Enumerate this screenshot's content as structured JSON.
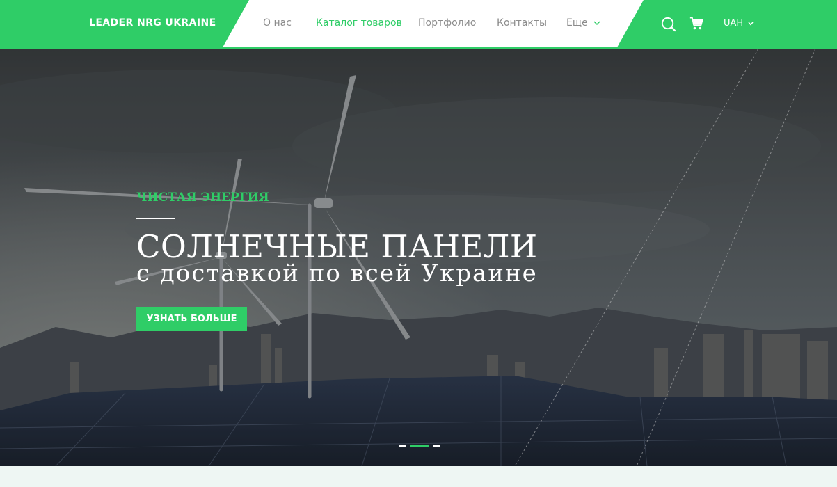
{
  "header": {
    "logo": "LEADER NRG UKRAINE",
    "nav": [
      {
        "label": "О нас",
        "active": false
      },
      {
        "label": "Каталог товаров",
        "active": true
      },
      {
        "label": "Портфолио",
        "active": false
      },
      {
        "label": "Контакты",
        "active": false
      },
      {
        "label": "Еще",
        "active": false
      }
    ],
    "currency": "UAH",
    "icons": [
      "search-icon",
      "cart-icon",
      "chevron-down-icon"
    ]
  },
  "hero": {
    "eyebrow": "ЧИСТАЯ ЭНЕРГИЯ",
    "title": "СОЛНЕЧНЫЕ ПАНЕЛИ",
    "subtitle": "с доставкой по всей Украине",
    "button": "УЗНАТЬ БОЛЬШЕ",
    "slides": 3,
    "active_slide": 2
  },
  "colors": {
    "brand_green": "#2fcd67",
    "nav_text": "#8c8c8c",
    "bottom_band": "#eef6f3"
  }
}
